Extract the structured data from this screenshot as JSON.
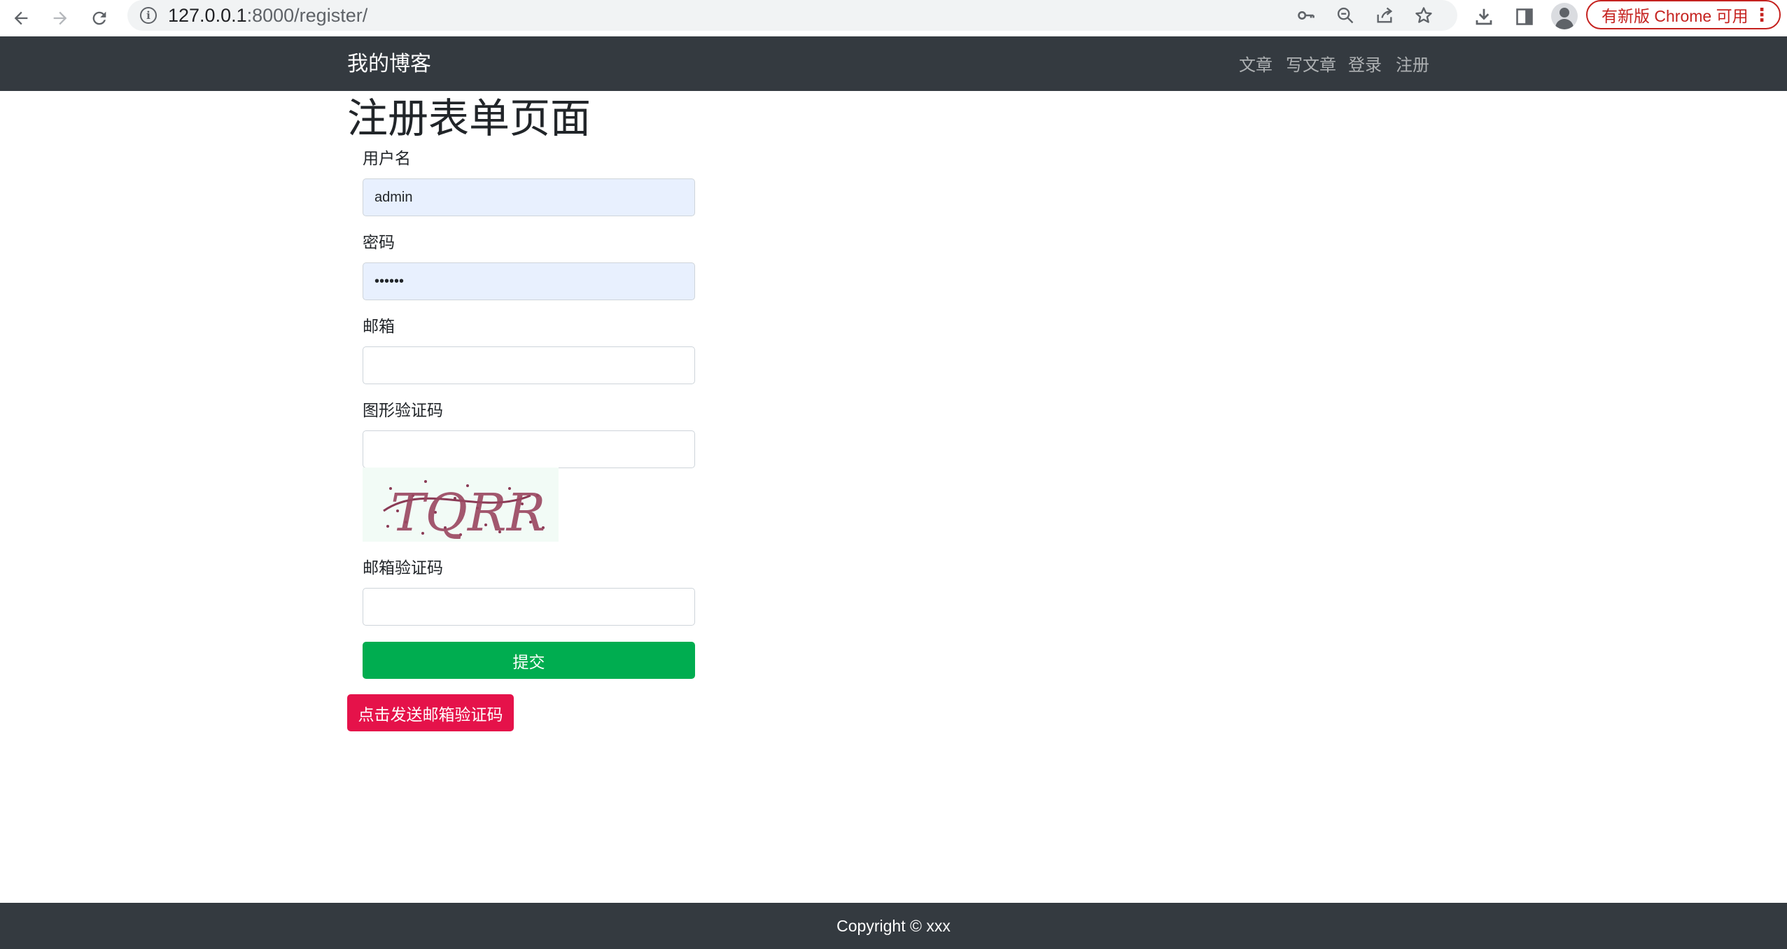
{
  "browser": {
    "url_host": "127.0.0.1",
    "url_rest": ":8000/register/",
    "update_label": "有新版 Chrome 可用",
    "icons": [
      "back-arrow-icon",
      "forward-arrow-icon",
      "reload-icon",
      "info-icon",
      "key-icon",
      "zoom-out-icon",
      "share-icon",
      "star-icon",
      "download-icon",
      "side-panel-icon",
      "profile-icon",
      "kebab-menu-icon"
    ]
  },
  "navbar": {
    "brand": "我的博客",
    "links": [
      "文章",
      "写文章",
      "登录",
      "注册"
    ]
  },
  "page": {
    "title": "注册表单页面"
  },
  "form": {
    "username_label": "用户名",
    "username_value": "admin",
    "password_label": "密码",
    "password_value": "123456",
    "email_label": "邮箱",
    "email_value": "",
    "captcha_label": "图形验证码",
    "captcha_value": "",
    "captcha_image_text": "TQRR",
    "email_code_label": "邮箱验证码",
    "email_code_value": "",
    "submit_label": "提交",
    "send_code_label": "点击发送邮箱验证码"
  },
  "footer": {
    "copyright": "Copyright © xxx"
  },
  "colors": {
    "navbar_bg": "#343a40",
    "submit_bg": "#00ad50",
    "send_bg": "#e5124a",
    "autofill_bg": "#e8f0fe"
  }
}
